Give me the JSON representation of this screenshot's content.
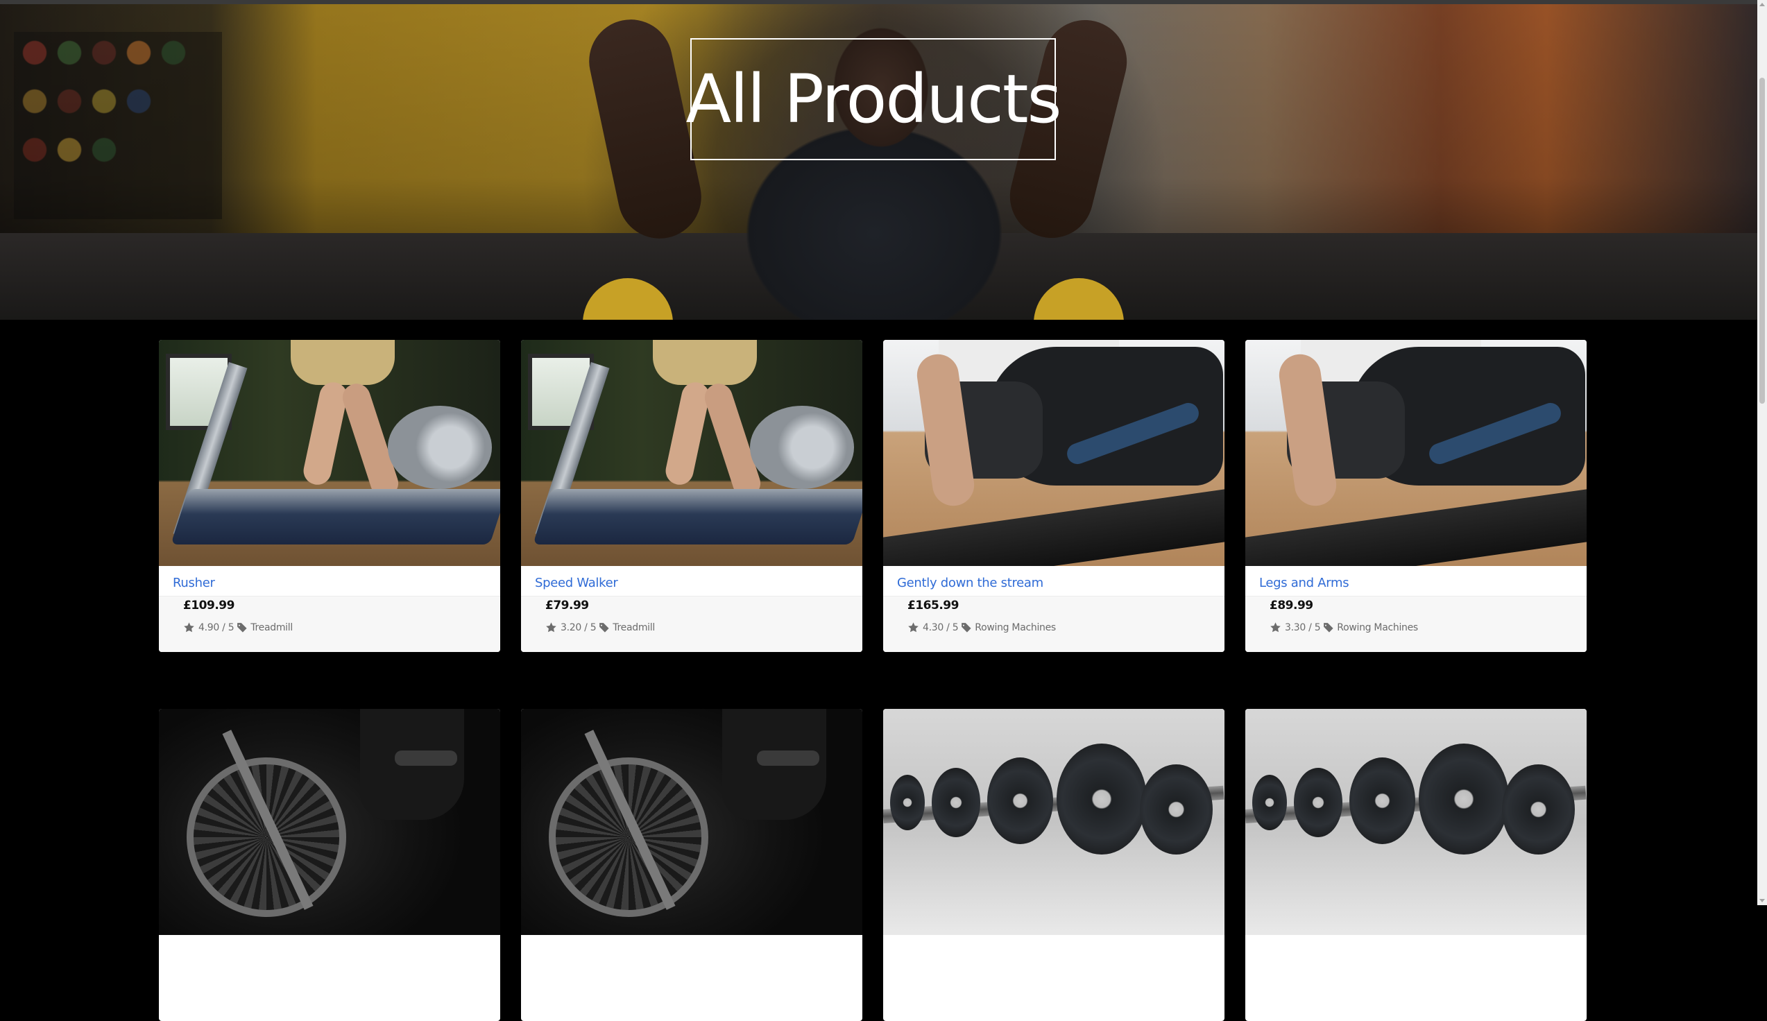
{
  "page": {
    "title": "All Products"
  },
  "products": [
    {
      "name": "Rusher",
      "price": "£109.99",
      "rating": "4.90 / 5",
      "category": "Treadmill",
      "image": "treadmill"
    },
    {
      "name": "Speed Walker",
      "price": "£79.99",
      "rating": "3.20 / 5",
      "category": "Treadmill",
      "image": "treadmill"
    },
    {
      "name": "Gently down the stream",
      "price": "£165.99",
      "rating": "4.30 / 5",
      "category": "Rowing Machines",
      "image": "rowing"
    },
    {
      "name": "Legs and Arms",
      "price": "£89.99",
      "rating": "3.30 / 5",
      "category": "Rowing Machines",
      "image": "rowing"
    },
    {
      "image": "air-bike"
    },
    {
      "image": "air-bike"
    },
    {
      "image": "dumbbells"
    },
    {
      "image": "dumbbells"
    }
  ],
  "icons": {
    "rating": "star-icon",
    "category": "tag-icon"
  },
  "colors": {
    "background": "#000000",
    "product_link": "#2f6bd6",
    "meta_text": "#6c6c6c",
    "card_footer": "#f7f7f7"
  }
}
